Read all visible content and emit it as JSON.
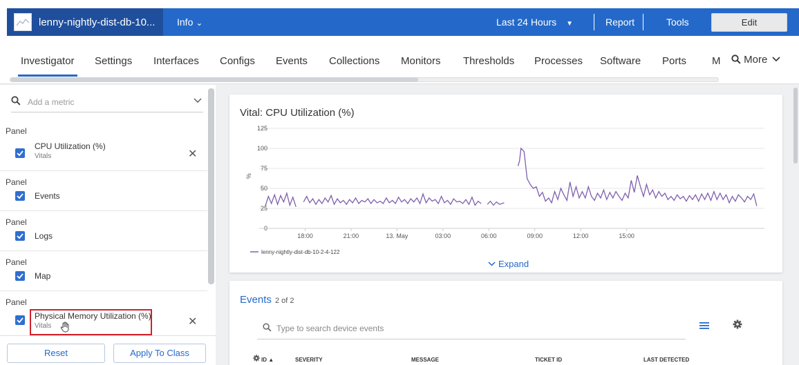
{
  "header": {
    "device_name": "lenny-nightly-dist-db-10...",
    "info_label": "Info",
    "time_range": "Last 24 Hours",
    "report_label": "Report",
    "tools_label": "Tools",
    "edit_label": "Edit"
  },
  "tabs": [
    {
      "label": "Investigator",
      "active": true
    },
    {
      "label": "Settings"
    },
    {
      "label": "Interfaces"
    },
    {
      "label": "Configs"
    },
    {
      "label": "Events"
    },
    {
      "label": "Collections"
    },
    {
      "label": "Monitors"
    },
    {
      "label": "Thresholds"
    },
    {
      "label": "Processes"
    },
    {
      "label": "Software"
    },
    {
      "label": "Ports"
    },
    {
      "label": "M"
    }
  ],
  "more_label": "More",
  "sidebar": {
    "search_placeholder": "Add a metric",
    "panels": [
      {
        "group": "Panel",
        "title": "CPU Utilization (%)",
        "sub": "Vitals",
        "checked": true,
        "removable": true
      },
      {
        "group": "Panel",
        "title": "Events",
        "checked": true
      },
      {
        "group": "Panel",
        "title": "Logs",
        "checked": true
      },
      {
        "group": "Panel",
        "title": "Map",
        "checked": true
      },
      {
        "group": "Panel",
        "title": "Physical Memory Utilization (%)",
        "sub": "Vitals",
        "checked": true,
        "removable": true
      }
    ],
    "reset_label": "Reset",
    "apply_label": "Apply To Class"
  },
  "chart_data": {
    "type": "line",
    "title": "Vital: CPU Utilization (%)",
    "ylabel": "%",
    "ylim": [
      0,
      125
    ],
    "yticks": [
      0,
      25,
      50,
      75,
      100,
      125
    ],
    "x_ticks": [
      "18:00",
      "21:00",
      "13. May",
      "03:00",
      "06:00",
      "09:00",
      "12:00",
      "15:00"
    ],
    "series": [
      {
        "name": "lenny-nightly-dist-db-10-2-4-122",
        "color": "#7e5fad",
        "segments": [
          [
            [
              15.4,
              28
            ],
            [
              15.6,
              40
            ],
            [
              15.8,
              31
            ],
            [
              16.0,
              42
            ],
            [
              16.2,
              30
            ],
            [
              16.4,
              41
            ],
            [
              16.6,
              33
            ],
            [
              16.8,
              44
            ],
            [
              17.0,
              29
            ],
            [
              17.2,
              39
            ],
            [
              17.4,
              27
            ]
          ],
          [
            [
              17.9,
              33
            ],
            [
              18.1,
              40
            ],
            [
              18.3,
              32
            ],
            [
              18.5,
              37
            ],
            [
              18.7,
              30
            ],
            [
              18.9,
              36
            ],
            [
              19.1,
              31
            ],
            [
              19.3,
              38
            ],
            [
              19.5,
              33
            ],
            [
              19.7,
              41
            ],
            [
              19.9,
              30
            ],
            [
              20.1,
              37
            ],
            [
              20.3,
              32
            ],
            [
              20.5,
              35
            ],
            [
              20.7,
              30
            ],
            [
              20.9,
              36
            ],
            [
              21.1,
              32
            ],
            [
              21.3,
              38
            ],
            [
              21.5,
              31
            ],
            [
              21.7,
              35
            ],
            [
              21.9,
              33
            ],
            [
              22.1,
              37
            ],
            [
              22.3,
              31
            ],
            [
              22.5,
              36
            ],
            [
              22.7,
              32
            ],
            [
              22.9,
              34
            ],
            [
              23.1,
              31
            ],
            [
              23.3,
              38
            ],
            [
              23.5,
              32
            ],
            [
              23.7,
              35
            ],
            [
              23.9,
              31
            ],
            [
              24.1,
              39
            ],
            [
              24.3,
              33
            ],
            [
              24.5,
              36
            ],
            [
              24.7,
              31
            ],
            [
              24.9,
              37
            ],
            [
              25.1,
              33
            ],
            [
              25.3,
              38
            ],
            [
              25.5,
              31
            ],
            [
              25.7,
              43
            ],
            [
              25.9,
              32
            ],
            [
              26.1,
              38
            ],
            [
              26.3,
              34
            ],
            [
              26.5,
              36
            ],
            [
              26.7,
              31
            ],
            [
              26.9,
              40
            ],
            [
              27.1,
              32
            ],
            [
              27.3,
              35
            ],
            [
              27.5,
              30
            ],
            [
              27.7,
              37
            ],
            [
              27.9,
              33
            ],
            [
              28.1,
              34
            ],
            [
              28.3,
              31
            ],
            [
              28.5,
              36
            ],
            [
              28.7,
              30
            ],
            [
              28.9,
              39
            ],
            [
              29.1,
              29
            ],
            [
              29.3,
              34
            ],
            [
              29.5,
              31
            ]
          ],
          [
            [
              29.9,
              30
            ],
            [
              30.1,
              34
            ],
            [
              30.3,
              29
            ],
            [
              30.5,
              33
            ],
            [
              30.7,
              30
            ],
            [
              31.0,
              32
            ]
          ],
          [
            [
              31.9,
              78
            ],
            [
              32.0,
              84
            ],
            [
              32.1,
              100
            ],
            [
              32.3,
              96
            ],
            [
              32.5,
              62
            ],
            [
              32.7,
              55
            ],
            [
              32.9,
              50
            ],
            [
              33.1,
              52
            ],
            [
              33.3,
              40
            ],
            [
              33.5,
              45
            ],
            [
              33.7,
              34
            ],
            [
              33.9,
              38
            ],
            [
              34.1,
              32
            ],
            [
              34.3,
              46
            ],
            [
              34.5,
              36
            ],
            [
              34.7,
              50
            ],
            [
              34.9,
              42
            ],
            [
              35.1,
              35
            ],
            [
              35.3,
              58
            ],
            [
              35.5,
              40
            ],
            [
              35.7,
              52
            ],
            [
              35.9,
              38
            ],
            [
              36.1,
              46
            ],
            [
              36.3,
              38
            ],
            [
              36.5,
              52
            ],
            [
              36.7,
              40
            ],
            [
              36.9,
              35
            ],
            [
              37.1,
              44
            ],
            [
              37.3,
              38
            ],
            [
              37.5,
              48
            ],
            [
              37.7,
              36
            ],
            [
              37.9,
              45
            ],
            [
              38.1,
              38
            ],
            [
              38.3,
              46
            ],
            [
              38.5,
              40
            ],
            [
              38.7,
              35
            ],
            [
              38.9,
              44
            ],
            [
              39.1,
              38
            ],
            [
              39.3,
              60
            ],
            [
              39.5,
              45
            ],
            [
              39.7,
              66
            ],
            [
              39.9,
              52
            ],
            [
              40.1,
              40
            ],
            [
              40.3,
              55
            ],
            [
              40.5,
              42
            ],
            [
              40.7,
              48
            ],
            [
              40.9,
              38
            ],
            [
              41.1,
              46
            ],
            [
              41.3,
              40
            ],
            [
              41.5,
              44
            ],
            [
              41.7,
              36
            ],
            [
              41.9,
              40
            ],
            [
              42.1,
              35
            ],
            [
              42.3,
              42
            ],
            [
              42.5,
              37
            ],
            [
              42.7,
              40
            ],
            [
              42.9,
              34
            ],
            [
              43.1,
              41
            ],
            [
              43.3,
              36
            ],
            [
              43.5,
              42
            ],
            [
              43.7,
              34
            ],
            [
              43.9,
              43
            ],
            [
              44.1,
              36
            ],
            [
              44.3,
              44
            ],
            [
              44.5,
              35
            ],
            [
              44.7,
              46
            ],
            [
              44.9,
              36
            ],
            [
              45.1,
              44
            ],
            [
              45.3,
              36
            ],
            [
              45.5,
              42
            ],
            [
              45.7,
              32
            ],
            [
              45.9,
              40
            ],
            [
              46.1,
              34
            ],
            [
              46.3,
              42
            ],
            [
              46.5,
              38
            ],
            [
              46.7,
              33
            ],
            [
              46.9,
              40
            ],
            [
              47.1,
              36
            ],
            [
              47.3,
              43
            ],
            [
              47.5,
              28
            ]
          ]
        ]
      }
    ]
  },
  "expand_label": "Expand",
  "events": {
    "title": "Events",
    "count": "2 of 2",
    "search_placeholder": "Type to search device events",
    "columns": [
      "ID",
      "SEVERITY",
      "MESSAGE",
      "TICKET ID",
      "LAST DETECTED"
    ]
  }
}
